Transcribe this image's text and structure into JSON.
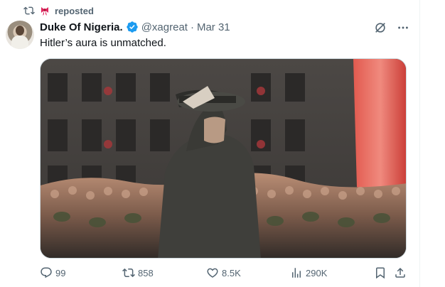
{
  "repost": {
    "icon": "repost-icon",
    "badge_icon": "ribbon-icon",
    "label": "reposted"
  },
  "author": {
    "name": "Duke Of Nigeria.",
    "handle": "@xagreat",
    "separator": "·",
    "date": "Mar 31",
    "verified": true,
    "verified_color": "#1d9bf0"
  },
  "tweet": {
    "text": "Hitler’s aura is unmatched."
  },
  "top_icons": [
    "grok-icon",
    "more-icon"
  ],
  "actions": {
    "replies": "99",
    "reposts": "858",
    "likes": "8.5K",
    "views": "290K",
    "icons": [
      "reply-icon",
      "repost-icon",
      "like-icon",
      "views-icon",
      "bookmark-icon",
      "share-icon"
    ]
  },
  "colors": {
    "text_primary": "#0f1419",
    "text_secondary": "#536471",
    "accent": "#1d9bf0",
    "ribbon": "#e0245e"
  }
}
